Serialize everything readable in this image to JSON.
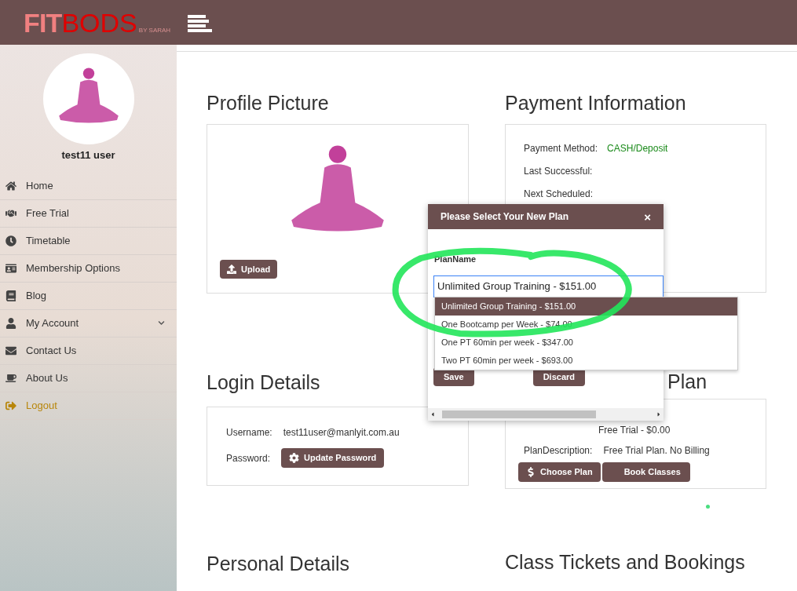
{
  "header": {
    "logo": {
      "part_1": "FIT",
      "part_2": "BODS",
      "tagline": "BY SARAH"
    }
  },
  "sidebar": {
    "user_name": "test11 user",
    "items": [
      {
        "label": "Home",
        "kind": "link"
      },
      {
        "label": "Free Trial",
        "kind": "link"
      },
      {
        "label": "Timetable",
        "kind": "link"
      },
      {
        "label": "Membership Options",
        "kind": "link"
      },
      {
        "label": "Blog",
        "kind": "link"
      },
      {
        "label": "My Account",
        "kind": "group",
        "expanded": false
      },
      {
        "label": "Contact Us",
        "kind": "link"
      },
      {
        "label": "About Us",
        "kind": "link"
      },
      {
        "label": "Logout",
        "kind": "logout"
      }
    ]
  },
  "profile_picture": {
    "title": "Profile Picture",
    "upload_button": "Upload"
  },
  "payment_information": {
    "title": "Payment Information",
    "rows": [
      {
        "label": "Payment Method:",
        "value": "CASH/Deposit"
      },
      {
        "label": "Last Successful:",
        "value": ""
      },
      {
        "label": "Next Scheduled:",
        "value": ""
      }
    ]
  },
  "login_details": {
    "title": "Login Details",
    "username_label": "Username:",
    "username": "test11user@manlyit.com.au",
    "password_label": "Password:",
    "update_button": "Update Password"
  },
  "current_plan": {
    "title": "Plan",
    "plan_value": "Free Trial - $0.00",
    "description_label": "PlanDescription:",
    "description": "Free Trial Plan. No Billing",
    "choose_button": "Choose Plan",
    "book_button": "Book Classes"
  },
  "personal_details": {
    "title": "Personal Details"
  },
  "class_tickets": {
    "title": "Class Tickets and Bookings"
  },
  "modal": {
    "title": "Please Select Your New Plan",
    "close": "×",
    "field_label": "PlanName",
    "value": "Unlimited Group Training - $151.00",
    "options": [
      {
        "label": "Unlimited Group Training - $151.00",
        "selected": true
      },
      {
        "label": "One Bootcamp per Week - $74.00",
        "selected": false
      },
      {
        "label": "One PT 60min per week - $347.00",
        "selected": false
      },
      {
        "label": "Two PT 60min per week - $693.00",
        "selected": false
      }
    ],
    "save_button": "Save",
    "discard_button": "Discard"
  }
}
